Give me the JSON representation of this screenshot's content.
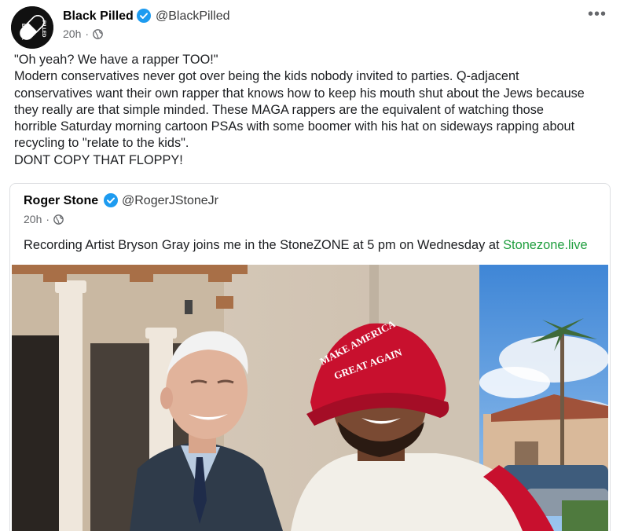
{
  "post": {
    "author": "Black Pilled",
    "handle": "@BlackPilled",
    "time": "20h",
    "privacy_icon": "globe-icon",
    "avatar_text": "BLACK PILLED",
    "body_lines": [
      "\"Oh yeah? We have a rapper TOO!\"",
      "Modern conservatives never got over being the kids nobody invited to parties. Q-adjacent",
      "conservatives want their own rapper that knows how to keep his mouth shut about the Jews because",
      "they really are that simple minded. These MAGA rappers are the equivalent of watching those",
      "horrible Saturday morning cartoon PSAs with some boomer with his hat on sideways rapping about",
      "recycling to \"relate to the kids\".",
      "DONT COPY THAT FLOPPY!"
    ]
  },
  "quoted": {
    "author": "Roger Stone",
    "handle": "@RogerJStoneJr",
    "time": "20h",
    "privacy_icon": "globe-icon",
    "text": "Recording Artist Bryson Gray joins me in the StoneZONE at 5 pm on Wednesday at ",
    "link": "Stonezone.live",
    "hat_text_line1": "MAKE AMERICA",
    "hat_text_line2": "GREAT AGAIN"
  },
  "colors": {
    "verified": "#1d9bf0",
    "link": "#1f9e3e",
    "hat": "#c8102e"
  }
}
